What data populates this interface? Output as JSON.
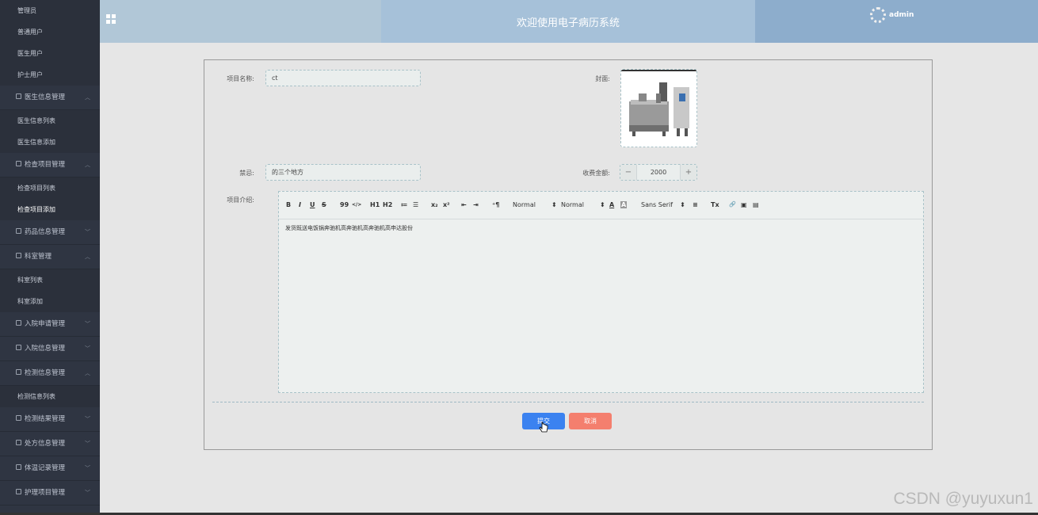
{
  "sidebar": {
    "items": [
      {
        "type": "sub",
        "label": "管理员"
      },
      {
        "type": "sub",
        "label": "普通用户"
      },
      {
        "type": "sub",
        "label": "医生用户"
      },
      {
        "type": "sub",
        "label": "护士用户"
      },
      {
        "type": "group",
        "label": "医生信息管理",
        "arrow": "^"
      },
      {
        "type": "sub",
        "label": "医生信息列表"
      },
      {
        "type": "sub",
        "label": "医生信息添加"
      },
      {
        "type": "group",
        "label": "检查项目管理",
        "arrow": "^"
      },
      {
        "type": "sub",
        "label": "检查项目列表"
      },
      {
        "type": "sub",
        "label": "检查项目添加",
        "active": true
      },
      {
        "type": "group",
        "label": "药品信息管理",
        "arrow": "v"
      },
      {
        "type": "group",
        "label": "科室管理",
        "arrow": "^"
      },
      {
        "type": "sub",
        "label": "科室列表"
      },
      {
        "type": "sub",
        "label": "科室添加"
      },
      {
        "type": "group",
        "label": "入院申请管理",
        "arrow": "v"
      },
      {
        "type": "group",
        "label": "入院信息管理",
        "arrow": "v"
      },
      {
        "type": "group",
        "label": "检测信息管理",
        "arrow": "^"
      },
      {
        "type": "sub",
        "label": "检测信息列表"
      },
      {
        "type": "group",
        "label": "检测结果管理",
        "arrow": "v"
      },
      {
        "type": "group",
        "label": "处方信息管理",
        "arrow": "v"
      },
      {
        "type": "group",
        "label": "体温记录管理",
        "arrow": "v"
      },
      {
        "type": "group",
        "label": "护理项目管理",
        "arrow": "v"
      }
    ]
  },
  "header": {
    "title": "欢迎使用电子病历系统",
    "username": "admin",
    "menu_icon": "grid-icon",
    "colors": {
      "left": "#b1c7d7",
      "mid": "#a6c1d9",
      "right": "#8dadcc"
    }
  },
  "form": {
    "project_name_label": "项目名称:",
    "project_name_value": "ct",
    "cover_label": "封面:",
    "taboo_label": "禁忌:",
    "taboo_value": "的三个地方",
    "fee_label": "收费金额:",
    "fee_value": "2000",
    "fee_minus": "−",
    "fee_plus": "+",
    "intro_label": "项目介绍:",
    "intro_content": "发货既送电饭锅奔驰机高奔驰机高奔驰机高申达股份",
    "submit_label": "提交",
    "cancel_label": "取消"
  },
  "toolbar": {
    "bold": "B",
    "italic": "I",
    "underline": "U",
    "strike": "S",
    "quote": "99",
    "code": "</>",
    "h1": "H1",
    "h2": "H2",
    "ordered_list": "≔",
    "bullet_list": "☰",
    "subscript": "x₂",
    "superscript": "x²",
    "outdent": "⇤",
    "indent": "⇥",
    "direction": "⁺¶",
    "size_select": "Normal",
    "header_select": "Normal",
    "font_color": "A",
    "bg_color": "A",
    "font_select": "Sans Serif",
    "align": "≡",
    "clean": "Tx",
    "link": "🔗",
    "image": "▣",
    "video": "▤"
  },
  "watermark": "CSDN @yuyuxun1"
}
